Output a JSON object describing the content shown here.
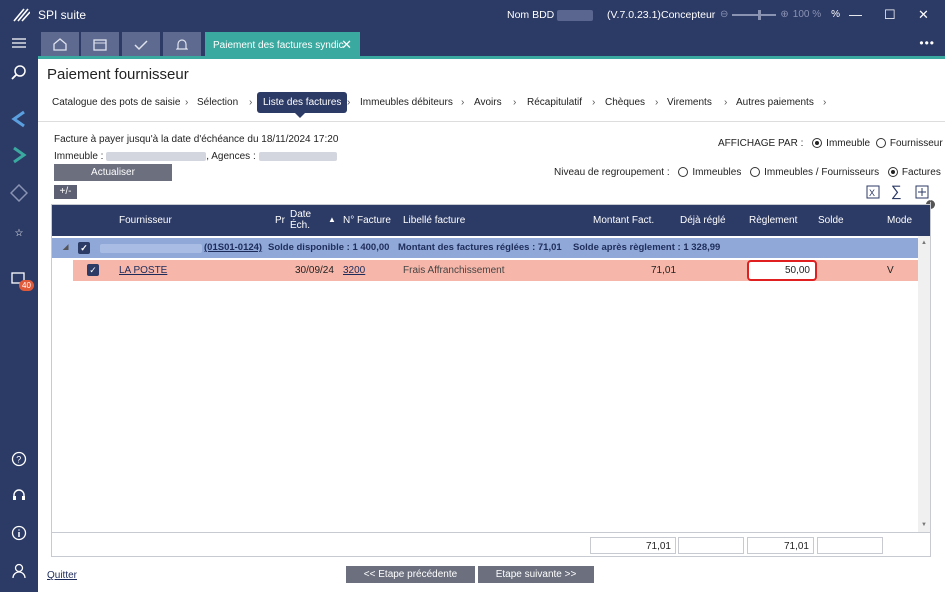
{
  "titlebar": {
    "app": "SPI suite",
    "bdd_label": "Nom BDD :",
    "version": "(V.7.0.23.1)",
    "role": "Concepteur",
    "zoom": "100 %",
    "percent_icon": "%"
  },
  "tabs": {
    "doc_title": "Paiement des factures syndic",
    "close": "✕"
  },
  "page_title": "Paiement fournisseur",
  "steps": [
    "Catalogue des pots de saisie",
    "Sélection",
    "Liste des factures",
    "Immeubles débiteurs",
    "Avoirs",
    "Récapitulatif",
    "Chèques",
    "Virements",
    "Autres paiements"
  ],
  "info": {
    "facture_line": "Facture à payer jusqu'à la date d'échéance du 18/11/2024 17:20",
    "immeuble_label": "Immeuble :",
    "agences_label": ", Agences :",
    "actualiser": "Actualiser",
    "plusminus": "+/-"
  },
  "affichage": {
    "label": "AFFICHAGE PAR :",
    "opt1": "Immeuble",
    "opt2": "Fournisseur"
  },
  "regroupement": {
    "label": "Niveau de regroupement :",
    "opt1": "Immeubles",
    "opt2": "Immeubles / Fournisseurs",
    "opt3": "Factures"
  },
  "columns": {
    "fournisseur": "Fournisseur",
    "pr": "Pr",
    "date_ech": "Date Éch.",
    "no_facture": "N° Facture",
    "libelle": "Libellé facture",
    "montant": "Montant Fact.",
    "deja": "Déjà réglé",
    "reglement": "Règlement",
    "solde": "Solde",
    "mode": "Mode"
  },
  "group": {
    "code": "(01S01-0124)",
    "solde_dispo": "Solde disponible : 1 400,00",
    "montant_regle": "Montant des factures réglées : 71,01",
    "solde_apres": "Solde après règlement : 1 328,99"
  },
  "row": {
    "fournisseur": "LA POSTE",
    "date": "30/09/24",
    "facture": "3200",
    "libelle": "Frais Affranchissement",
    "montant": "71,01",
    "reglement": "50,00",
    "mode": "V"
  },
  "totals": {
    "montant": "71,01",
    "reglement": "71,01"
  },
  "footer": {
    "quitter": "Quitter",
    "prev": "<< Etape précédente",
    "next": "Etape suivante >>"
  },
  "sidebar": {
    "badge": "40"
  },
  "colors": {
    "navy": "#2c3a66",
    "teal": "#3aa99f",
    "row_highlight": "#f6b6a9",
    "group_row": "#8fa8d8"
  }
}
